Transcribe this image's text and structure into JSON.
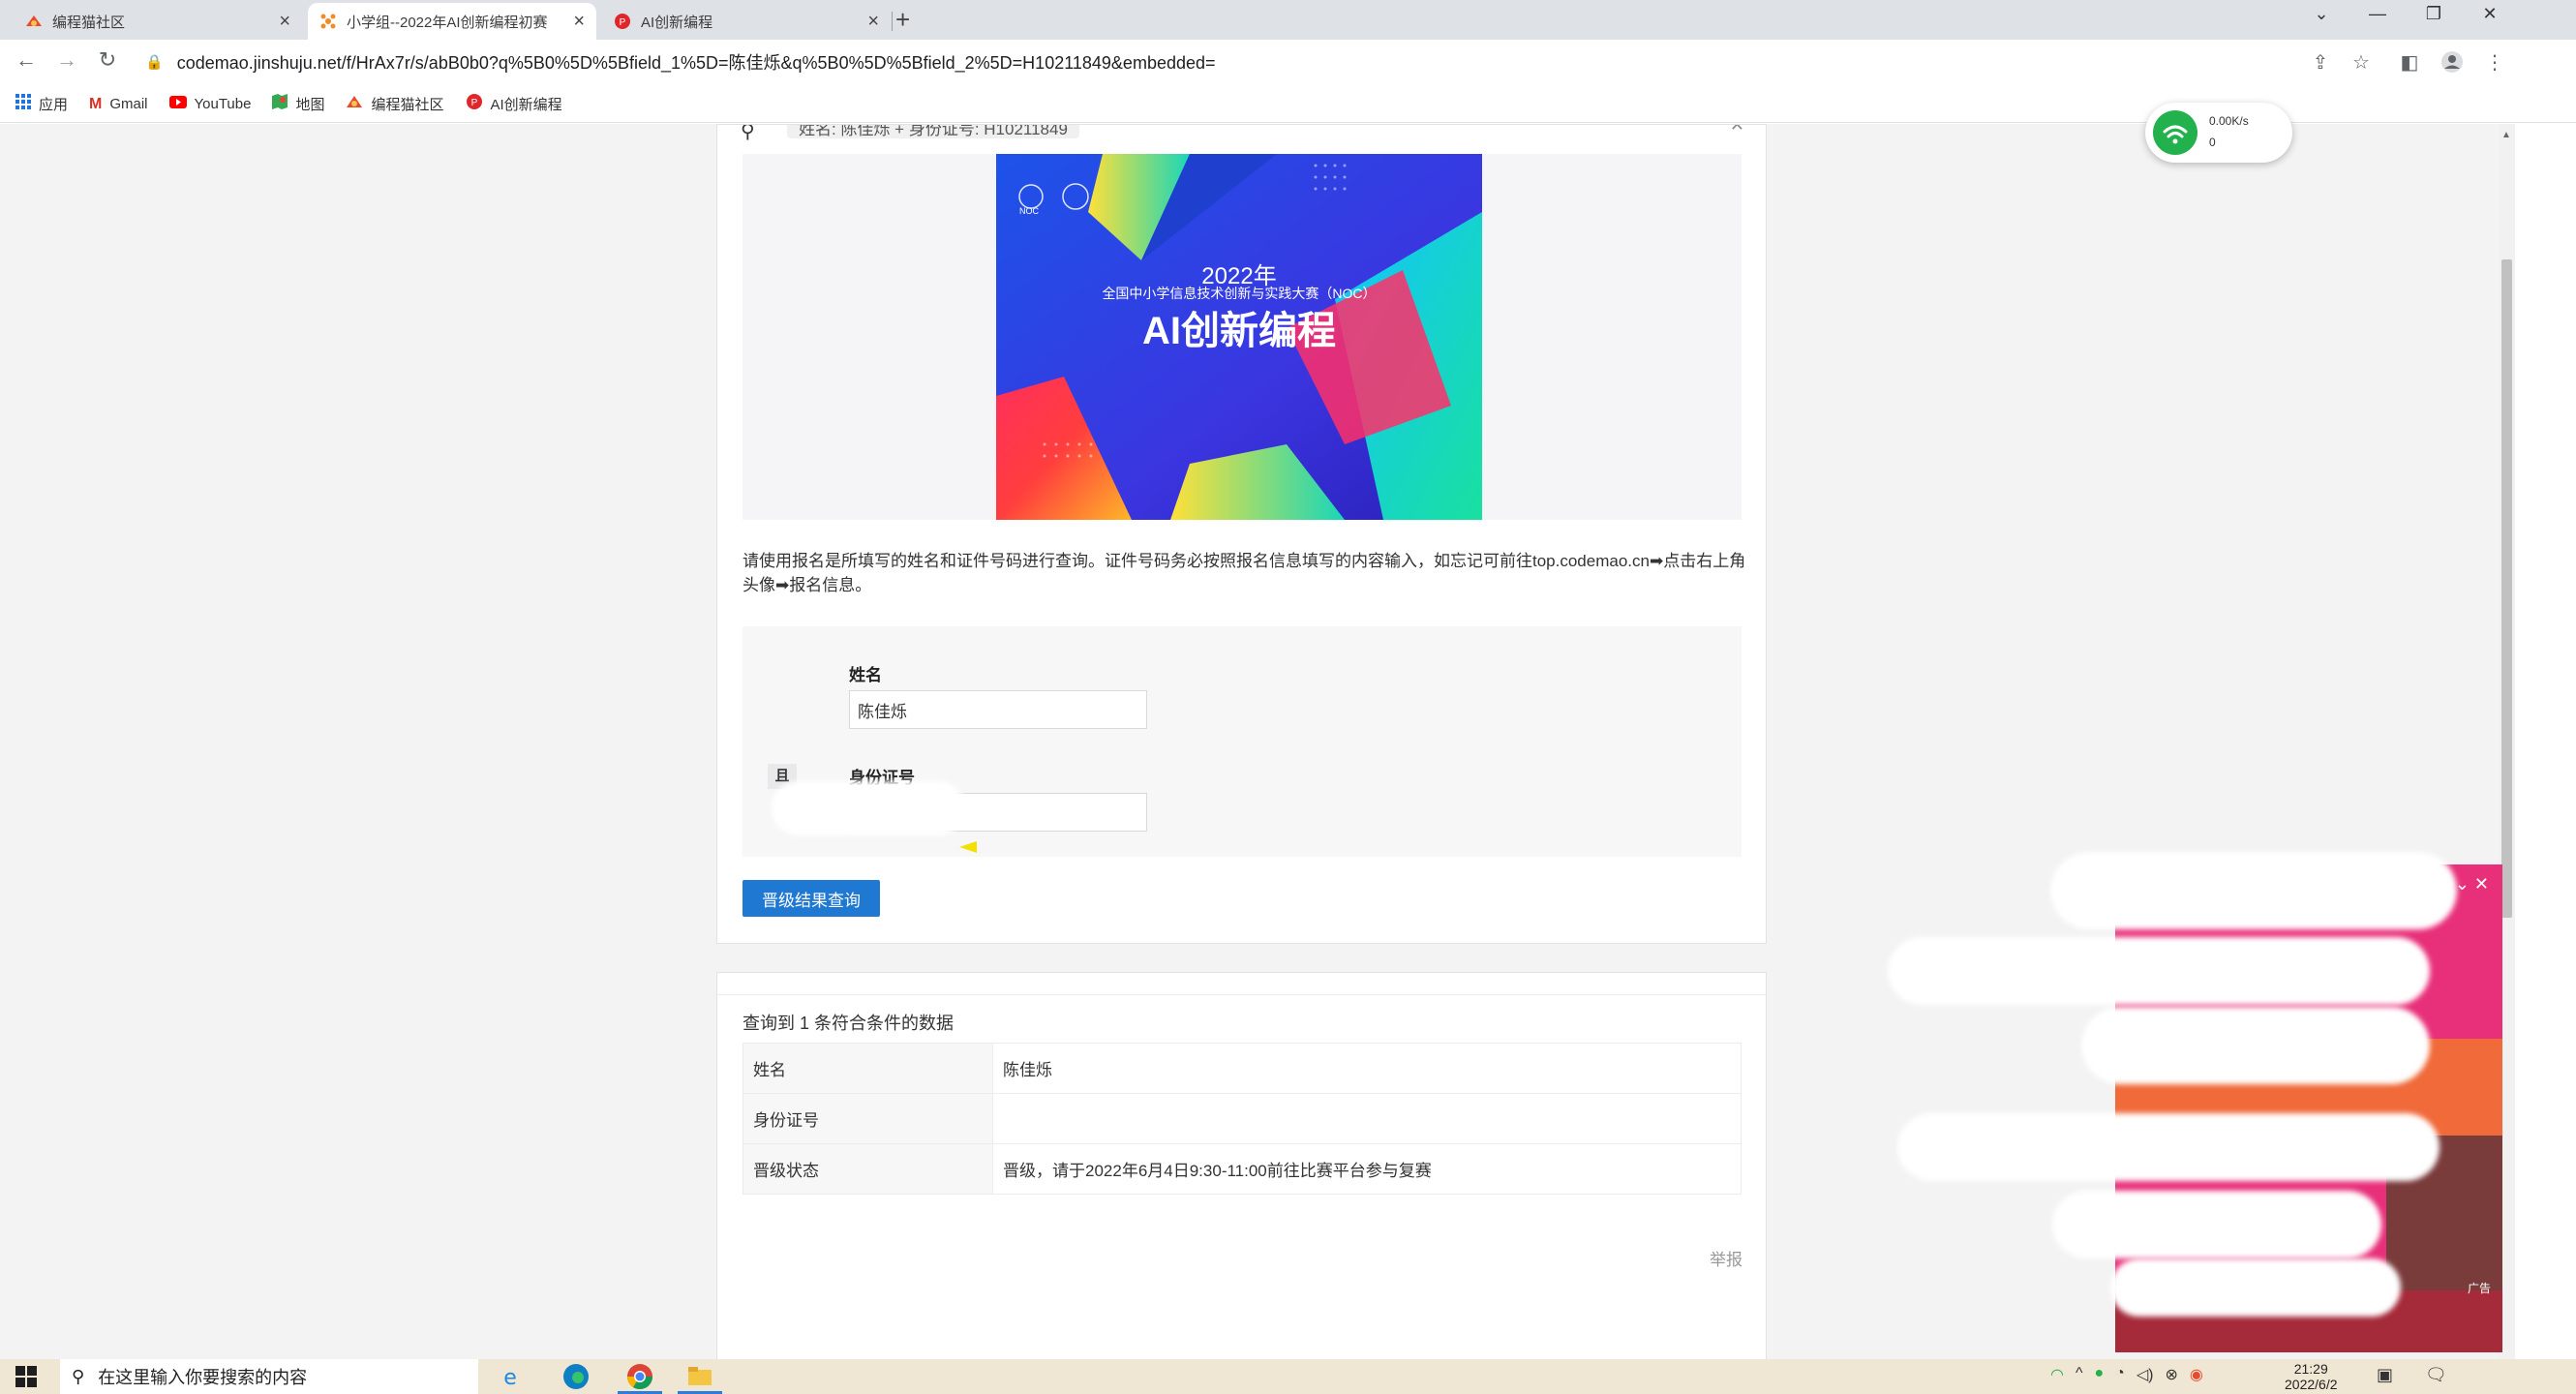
{
  "browser": {
    "tabs": [
      {
        "title": "编程猫社区",
        "active": false
      },
      {
        "title": "小学组--2022年AI创新编程初赛",
        "active": true
      },
      {
        "title": "AI创新编程",
        "active": false
      }
    ],
    "url": "codemao.jinshuju.net/f/HrAx7r/s/abB0b0?q%5B0%5D%5Bfield_1%5D=陈佳烁&q%5B0%5D%5Bfield_2%5D=H10211849&embedded=",
    "bookmarks": [
      {
        "label": "应用",
        "icon": "apps-grid-icon"
      },
      {
        "label": "Gmail",
        "icon": "gmail-icon"
      },
      {
        "label": "YouTube",
        "icon": "youtube-icon"
      },
      {
        "label": "地图",
        "icon": "maps-icon"
      },
      {
        "label": "编程猫社区",
        "icon": "codemao-icon"
      },
      {
        "label": "AI创新编程",
        "icon": "ai-coding-icon"
      }
    ]
  },
  "page": {
    "search_chip": "姓名: 陈佳烁 + 身份证号: H10211849",
    "banner": {
      "year": "2022年",
      "subtitle": "全国中小学信息技术创新与实践大赛（NOC）",
      "title": "AI创新编程",
      "logo_text": "NOC"
    },
    "description": "请使用报名是所填写的姓名和证件号码进行查询。证件号码务必按照报名信息填写的内容输入，如忘记可前往top.codemao.cn➡点击右上角头像➡报名信息。",
    "form": {
      "name_label": "姓名",
      "name_value": "陈佳烁",
      "id_label": "身份证号",
      "id_icon_text": "且",
      "id_value": ""
    },
    "submit_label": "晋级结果查询",
    "results": {
      "count_text": "查询到 1 条符合条件的数据",
      "rows": [
        {
          "key": "姓名",
          "value": "陈佳烁"
        },
        {
          "key": "身份证号",
          "value": ""
        },
        {
          "key": "晋级状态",
          "value": "晋级，请于2022年6月4日9:30-11:00前往比赛平台参与复赛"
        }
      ],
      "report_label": "举报"
    }
  },
  "widgets": {
    "wifi_speed": "0.00K/s",
    "wifi_count": "0",
    "ad_tag": "广告"
  },
  "taskbar": {
    "search_placeholder": "在这里输入你要搜索的内容",
    "time": "21:29",
    "date": "2022/6/2"
  },
  "colors": {
    "accent": "#1f78d1",
    "tabbar": "#dee1e6",
    "page_bg": "#f3f3f3",
    "taskbar": "#f0e6d4",
    "ad_bg": "#e8307a"
  }
}
